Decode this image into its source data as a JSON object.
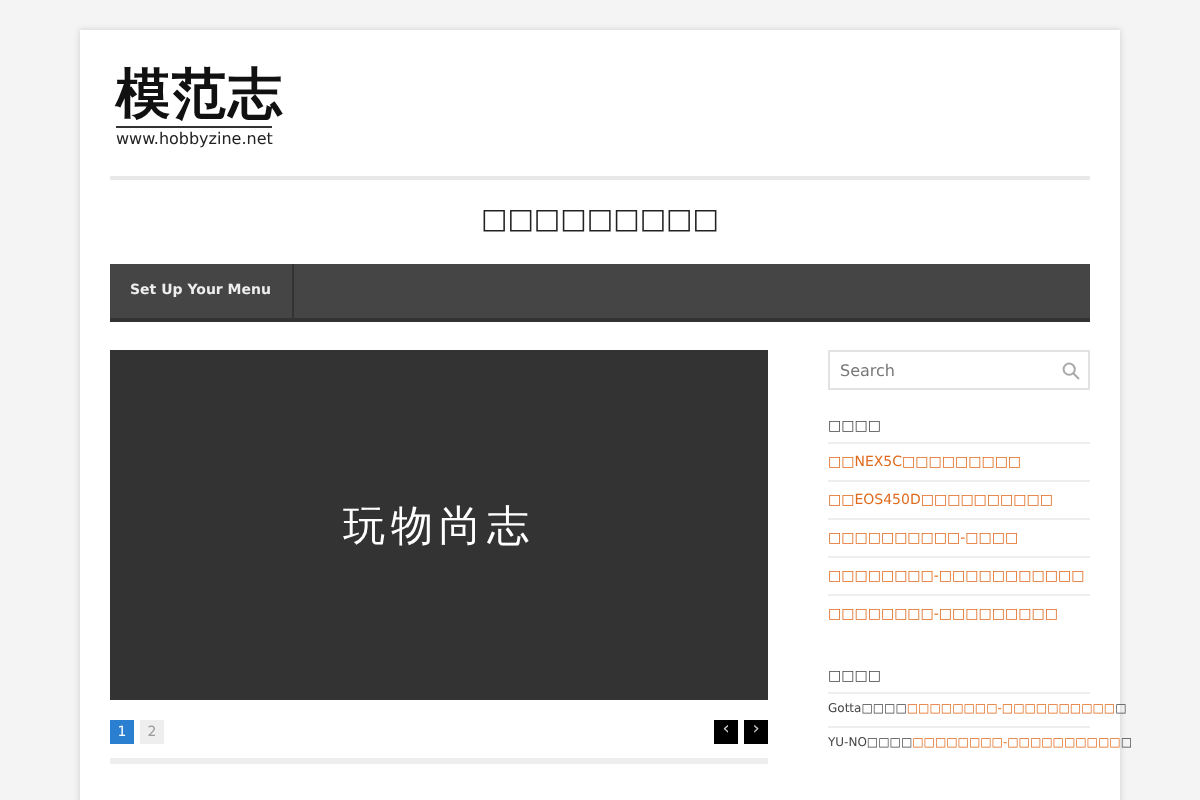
{
  "logo": {
    "name": "模范志",
    "url": "www.hobbyzine.net"
  },
  "site_title": "□□□□□□□□□",
  "nav": {
    "items": [
      {
        "label": "Set Up Your Menu"
      }
    ]
  },
  "slider": {
    "banner_text": "玩物尚志",
    "pages": [
      {
        "label": "1",
        "selected": true
      },
      {
        "label": "2",
        "selected": false
      }
    ],
    "prev": "‹",
    "next": "›"
  },
  "sidebar": {
    "search": {
      "placeholder": "Search"
    },
    "recent_posts": {
      "heading": "□□□□",
      "items": [
        "□□NEX5C□□□□□□□□□",
        "□□EOS450D□□□□□□□□□□",
        "□□□□□□□□□□-□□□□",
        "□□□□□□□□-□□□□□□□□□□□",
        "□□□□□□□□-□□□□□□□□□"
      ]
    },
    "recent_comments": {
      "heading": "□□□□",
      "items": [
        {
          "author": "Gotta□□□□",
          "link": "□□□□□□□□-□□□□□□□□□□",
          "tail": "□"
        },
        {
          "author": "YU-NO□□□□",
          "link": "□□□□□□□□-□□□□□□□□□□",
          "tail": "□"
        }
      ]
    }
  }
}
